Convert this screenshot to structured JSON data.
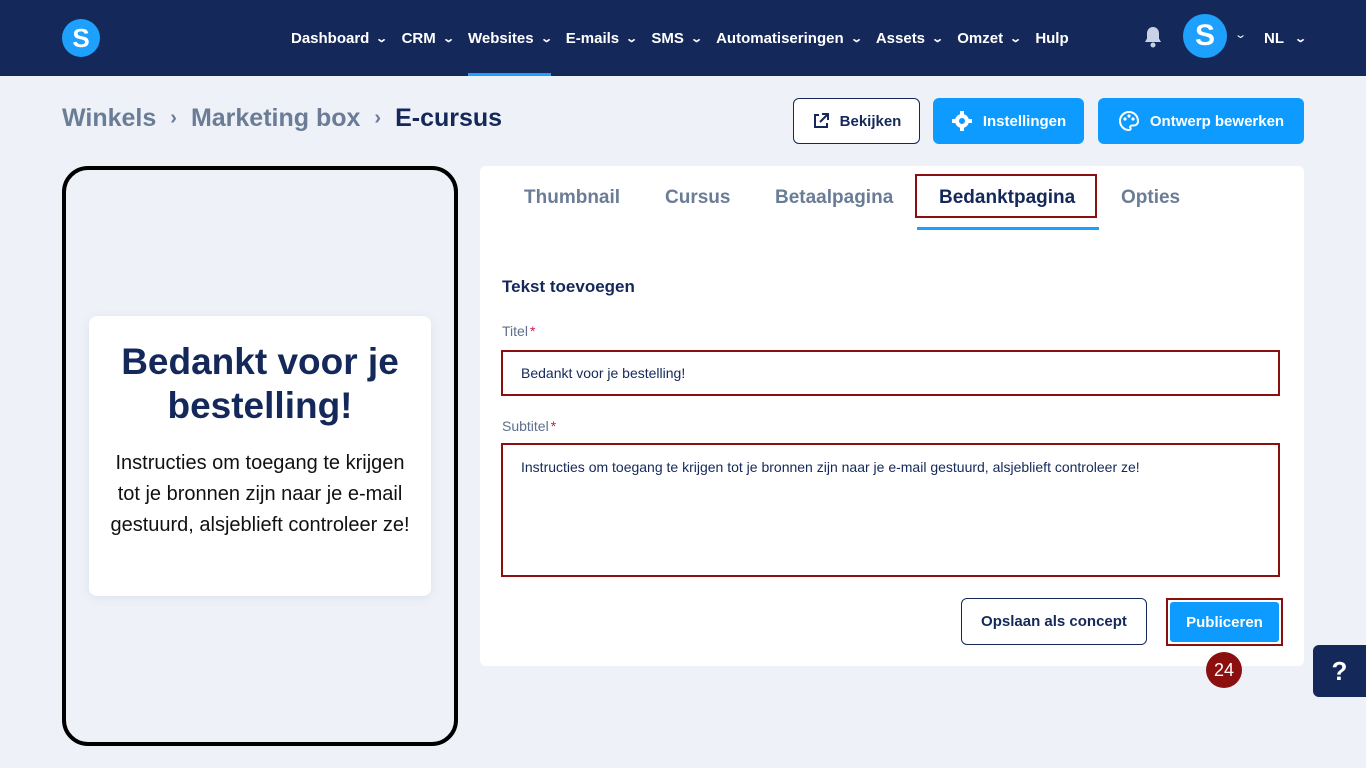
{
  "nav": {
    "items": [
      {
        "label": "Dashboard",
        "active": false
      },
      {
        "label": "CRM",
        "active": false
      },
      {
        "label": "Websites",
        "active": true
      },
      {
        "label": "E-mails",
        "active": false
      },
      {
        "label": "SMS",
        "active": false
      },
      {
        "label": "Automatiseringen",
        "active": false
      },
      {
        "label": "Assets",
        "active": false
      },
      {
        "label": "Omzet",
        "active": false
      }
    ],
    "help_label": "Hulp",
    "avatar_letter": "S",
    "language": "NL",
    "logo_letter": "S"
  },
  "breadcrumb": [
    "Winkels",
    "Marketing box",
    "E-cursus"
  ],
  "header_buttons": {
    "view": "Bekijken",
    "settings": "Instellingen",
    "edit_design": "Ontwerp bewerken"
  },
  "preview": {
    "title": "Bedankt voor je bestelling!",
    "subtitle": "Instructies om toegang te krijgen tot je bronnen zijn naar je e-mail gestuurd, alsjeblieft controleer ze!"
  },
  "tabs": [
    {
      "label": "Thumbnail",
      "active": false
    },
    {
      "label": "Cursus",
      "active": false
    },
    {
      "label": "Betaalpagina",
      "active": false
    },
    {
      "label": "Bedanktpagina",
      "active": true
    },
    {
      "label": "Opties",
      "active": false
    }
  ],
  "form": {
    "section_title": "Tekst toevoegen",
    "title_label": "Titel",
    "title_value": "Bedankt voor je bestelling!",
    "subtitle_label": "Subtitel",
    "subtitle_value": "Instructies om toegang te krijgen tot je bronnen zijn naar je e-mail gestuurd, alsjeblieft controleer ze!",
    "required_mark": "*"
  },
  "actions": {
    "save_draft": "Opslaan als concept",
    "publish": "Publiceren"
  },
  "step_badge": "24",
  "help_button": "?",
  "colors": {
    "navy": "#14285a",
    "accent": "#1ea0ff",
    "primary_button": "#0d9bff",
    "highlight": "#8b0f0f",
    "background": "#eef2f8"
  }
}
